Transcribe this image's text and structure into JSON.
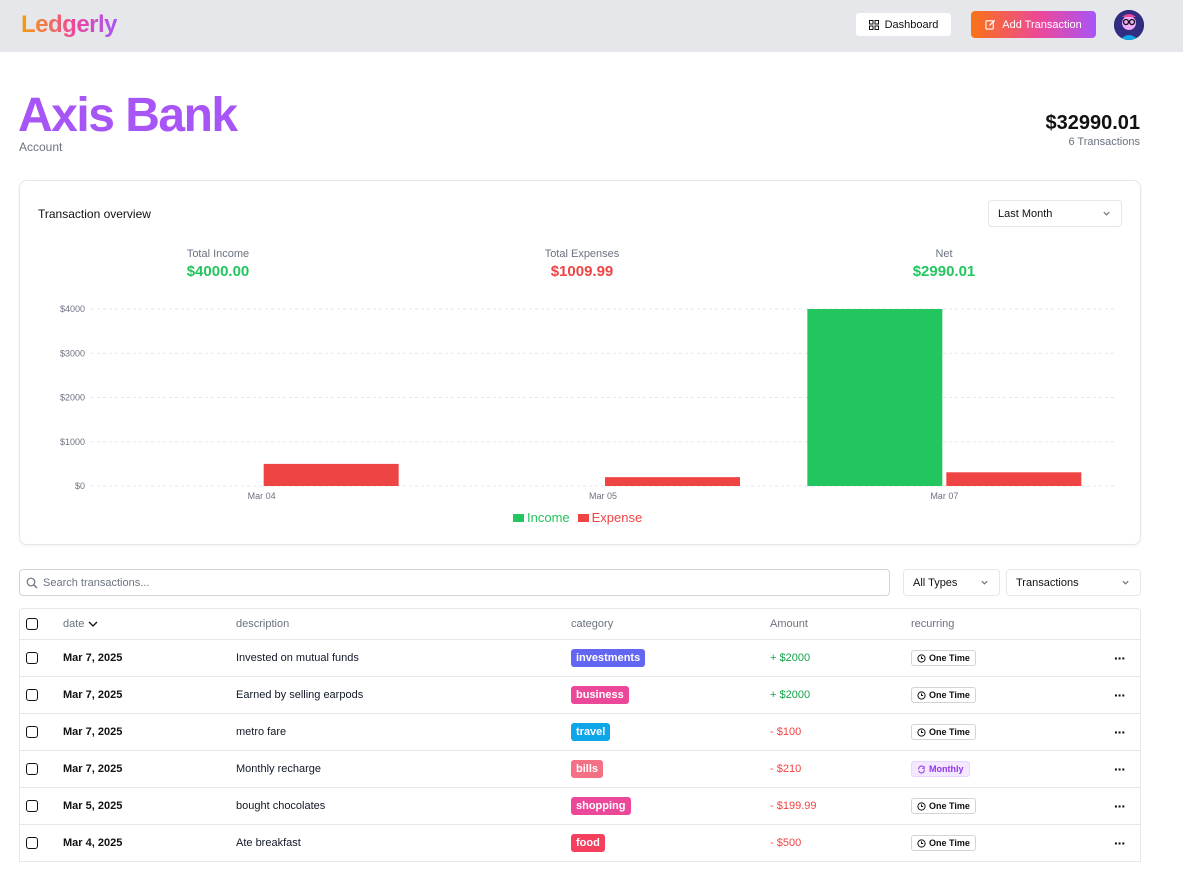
{
  "header": {
    "logo": "Ledgerly",
    "dashboard_label": "Dashboard",
    "add_transaction_label": "Add Transaction"
  },
  "account": {
    "name": "Axis Bank",
    "subtitle": "Account",
    "balance": "$32990.01",
    "transaction_count": "6 Transactions"
  },
  "overview": {
    "title": "Transaction overview",
    "period": "Last Month",
    "stats": {
      "income_label": "Total Income",
      "income_value": "$4000.00",
      "expenses_label": "Total Expenses",
      "expenses_value": "$1009.99",
      "net_label": "Net",
      "net_value": "$2990.01"
    }
  },
  "colors": {
    "income": "#22c55e",
    "expense": "#ef4444",
    "accent": "#a855f7"
  },
  "chart_data": {
    "type": "bar",
    "categories": [
      "Mar 04",
      "Mar 05",
      "Mar 07"
    ],
    "series": [
      {
        "name": "Income",
        "values": [
          0,
          0,
          4000
        ]
      },
      {
        "name": "Expense",
        "values": [
          500,
          199.99,
          310
        ]
      }
    ],
    "yticks": [
      "$0",
      "$1000",
      "$2000",
      "$3000",
      "$4000"
    ],
    "ylim": [
      0,
      4000
    ],
    "grid": true,
    "legend": "bottom-center"
  },
  "filters": {
    "search_placeholder": "Search transactions...",
    "type_select": "All Types",
    "view_select": "Transactions"
  },
  "table": {
    "headers": {
      "date": "date",
      "description": "description",
      "category": "category",
      "amount": "Amount",
      "recurring": "recurring"
    },
    "rows": [
      {
        "date": "Mar 7, 2025",
        "description": "Invested on mutual funds",
        "category": "investments",
        "category_color": "#6366f1",
        "amount": "+ $2000",
        "type": "income",
        "recurring": "One Time"
      },
      {
        "date": "Mar 7, 2025",
        "description": "Earned by selling earpods",
        "category": "business",
        "category_color": "#ec4899",
        "amount": "+ $2000",
        "type": "income",
        "recurring": "One Time"
      },
      {
        "date": "Mar 7, 2025",
        "description": "metro fare",
        "category": "travel",
        "category_color": "#0ea5e9",
        "amount": "- $100",
        "type": "expense",
        "recurring": "One Time"
      },
      {
        "date": "Mar 7, 2025",
        "description": "Monthly recharge",
        "category": "bills",
        "category_color": "#f47185",
        "amount": "- $210",
        "type": "expense",
        "recurring": "Monthly"
      },
      {
        "date": "Mar 5, 2025",
        "description": "bought chocolates",
        "category": "shopping",
        "category_color": "#ec4899",
        "amount": "- $199.99",
        "type": "expense",
        "recurring": "One Time"
      },
      {
        "date": "Mar 4, 2025",
        "description": "Ate breakfast",
        "category": "food",
        "category_color": "#f43f5e",
        "amount": "- $500",
        "type": "expense",
        "recurring": "One Time"
      }
    ]
  }
}
